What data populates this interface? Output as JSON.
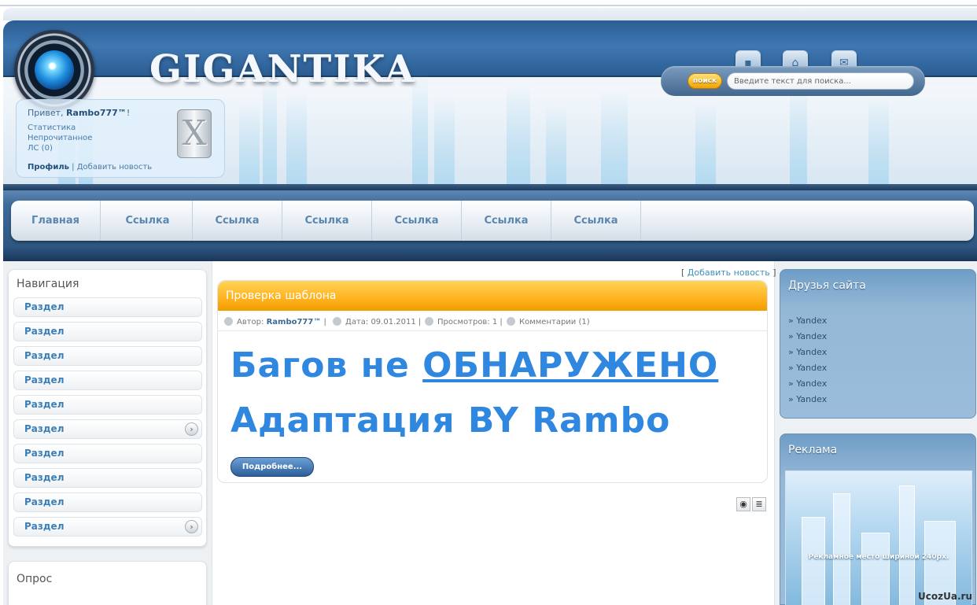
{
  "site": {
    "logo": "GIGANTIKA"
  },
  "header": {
    "icons": [
      "sitemap-icon",
      "home-icon",
      "mail-icon"
    ],
    "search": {
      "button_label": "поиск",
      "placeholder": "Введите текст для поиска..."
    }
  },
  "user_panel": {
    "greeting_prefix": "Привет, ",
    "username": "Rambo777™",
    "greeting_suffix": "!",
    "links": [
      "Статистика",
      "Непрочитанное",
      "ЛС (0)"
    ],
    "profile": "Профиль",
    "separator": " | ",
    "add_news": "Добавить новость",
    "logout_symbol": "X"
  },
  "nav": {
    "items": [
      "Главная",
      "Ссылка",
      "Ссылка",
      "Ссылка",
      "Ссылка",
      "Ссылка",
      "Ссылка"
    ]
  },
  "sidebar_left": {
    "title": "Навигация",
    "items": [
      {
        "label": "Раздел",
        "arrow": false
      },
      {
        "label": "Раздел",
        "arrow": false
      },
      {
        "label": "Раздел",
        "arrow": false
      },
      {
        "label": "Раздел",
        "arrow": false
      },
      {
        "label": "Раздел",
        "arrow": false
      },
      {
        "label": "Раздел",
        "arrow": true
      },
      {
        "label": "Раздел",
        "arrow": false
      },
      {
        "label": "Раздел",
        "arrow": false
      },
      {
        "label": "Раздел",
        "arrow": false
      },
      {
        "label": "Раздел",
        "arrow": true
      }
    ],
    "poll_title": "Опрос"
  },
  "content": {
    "add_news_open": "[ ",
    "add_news_label": "Добавить новость",
    "add_news_close": " ]",
    "post": {
      "title": "Проверка шаблона",
      "author_label": "Автор: ",
      "author": "Rambo777™",
      "date": "Дата: 09.01.2011",
      "views": "Просмотров: 1",
      "comments": "Комментарии (1)",
      "line1_prefix": "Багов не ",
      "line1_underlined": "ОБНАРУЖЕНО",
      "line2": "Адаптация BY Rambo",
      "more_button": "Подробнее..."
    }
  },
  "sidebar_right": {
    "friends_title": "Друзья сайта",
    "friends": [
      "» Yandex",
      "» Yandex",
      "» Yandex",
      "» Yandex",
      "» Yandex",
      "» Yandex"
    ],
    "ads_title": "Реклама",
    "ad_text": "Рекламное  место шириной 240px."
  },
  "watermark": "UcozUa.ru"
}
